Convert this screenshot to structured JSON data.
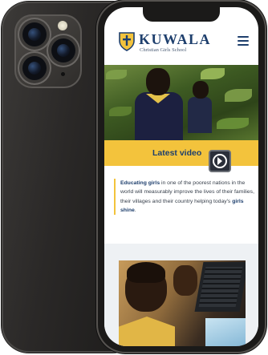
{
  "site": {
    "brand": "KUWALA",
    "tagline": "Christian Girls School"
  },
  "menu": {
    "icon": "hamburger-menu-icon"
  },
  "hero": {
    "image": "student-in-garden-photo"
  },
  "video": {
    "label": "Latest video",
    "icon": "play-icon"
  },
  "intro": {
    "lead": "Educating girls",
    "text_1": " in one of the poorest nations in the world will measurably improve the lives of their families, their villages and their country helping today's ",
    "highlight": "girls shine",
    "end": "."
  },
  "second_photo": {
    "image": "student-at-laptop-photo"
  },
  "colors": {
    "navy": "#1e3f6d",
    "gold": "#f3c33c",
    "phone_body": "#2a2827"
  }
}
